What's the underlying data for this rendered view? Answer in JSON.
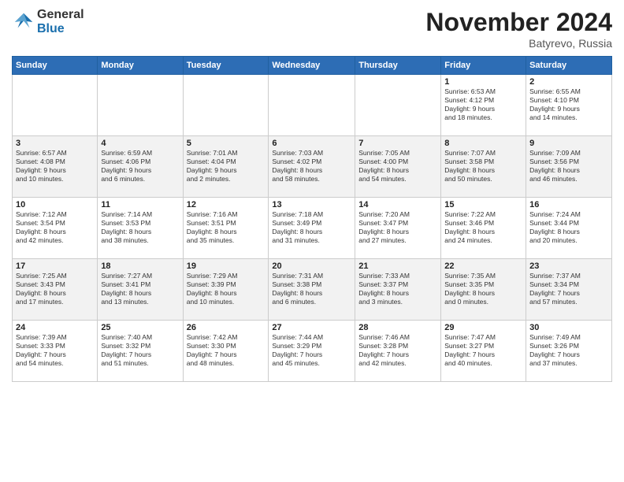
{
  "logo": {
    "general": "General",
    "blue": "Blue"
  },
  "header": {
    "month": "November 2024",
    "location": "Batyrevo, Russia"
  },
  "weekdays": [
    "Sunday",
    "Monday",
    "Tuesday",
    "Wednesday",
    "Thursday",
    "Friday",
    "Saturday"
  ],
  "weeks": [
    [
      {
        "day": "",
        "info": ""
      },
      {
        "day": "",
        "info": ""
      },
      {
        "day": "",
        "info": ""
      },
      {
        "day": "",
        "info": ""
      },
      {
        "day": "",
        "info": ""
      },
      {
        "day": "1",
        "info": "Sunrise: 6:53 AM\nSunset: 4:12 PM\nDaylight: 9 hours\nand 18 minutes."
      },
      {
        "day": "2",
        "info": "Sunrise: 6:55 AM\nSunset: 4:10 PM\nDaylight: 9 hours\nand 14 minutes."
      }
    ],
    [
      {
        "day": "3",
        "info": "Sunrise: 6:57 AM\nSunset: 4:08 PM\nDaylight: 9 hours\nand 10 minutes."
      },
      {
        "day": "4",
        "info": "Sunrise: 6:59 AM\nSunset: 4:06 PM\nDaylight: 9 hours\nand 6 minutes."
      },
      {
        "day": "5",
        "info": "Sunrise: 7:01 AM\nSunset: 4:04 PM\nDaylight: 9 hours\nand 2 minutes."
      },
      {
        "day": "6",
        "info": "Sunrise: 7:03 AM\nSunset: 4:02 PM\nDaylight: 8 hours\nand 58 minutes."
      },
      {
        "day": "7",
        "info": "Sunrise: 7:05 AM\nSunset: 4:00 PM\nDaylight: 8 hours\nand 54 minutes."
      },
      {
        "day": "8",
        "info": "Sunrise: 7:07 AM\nSunset: 3:58 PM\nDaylight: 8 hours\nand 50 minutes."
      },
      {
        "day": "9",
        "info": "Sunrise: 7:09 AM\nSunset: 3:56 PM\nDaylight: 8 hours\nand 46 minutes."
      }
    ],
    [
      {
        "day": "10",
        "info": "Sunrise: 7:12 AM\nSunset: 3:54 PM\nDaylight: 8 hours\nand 42 minutes."
      },
      {
        "day": "11",
        "info": "Sunrise: 7:14 AM\nSunset: 3:53 PM\nDaylight: 8 hours\nand 38 minutes."
      },
      {
        "day": "12",
        "info": "Sunrise: 7:16 AM\nSunset: 3:51 PM\nDaylight: 8 hours\nand 35 minutes."
      },
      {
        "day": "13",
        "info": "Sunrise: 7:18 AM\nSunset: 3:49 PM\nDaylight: 8 hours\nand 31 minutes."
      },
      {
        "day": "14",
        "info": "Sunrise: 7:20 AM\nSunset: 3:47 PM\nDaylight: 8 hours\nand 27 minutes."
      },
      {
        "day": "15",
        "info": "Sunrise: 7:22 AM\nSunset: 3:46 PM\nDaylight: 8 hours\nand 24 minutes."
      },
      {
        "day": "16",
        "info": "Sunrise: 7:24 AM\nSunset: 3:44 PM\nDaylight: 8 hours\nand 20 minutes."
      }
    ],
    [
      {
        "day": "17",
        "info": "Sunrise: 7:25 AM\nSunset: 3:43 PM\nDaylight: 8 hours\nand 17 minutes."
      },
      {
        "day": "18",
        "info": "Sunrise: 7:27 AM\nSunset: 3:41 PM\nDaylight: 8 hours\nand 13 minutes."
      },
      {
        "day": "19",
        "info": "Sunrise: 7:29 AM\nSunset: 3:39 PM\nDaylight: 8 hours\nand 10 minutes."
      },
      {
        "day": "20",
        "info": "Sunrise: 7:31 AM\nSunset: 3:38 PM\nDaylight: 8 hours\nand 6 minutes."
      },
      {
        "day": "21",
        "info": "Sunrise: 7:33 AM\nSunset: 3:37 PM\nDaylight: 8 hours\nand 3 minutes."
      },
      {
        "day": "22",
        "info": "Sunrise: 7:35 AM\nSunset: 3:35 PM\nDaylight: 8 hours\nand 0 minutes."
      },
      {
        "day": "23",
        "info": "Sunrise: 7:37 AM\nSunset: 3:34 PM\nDaylight: 7 hours\nand 57 minutes."
      }
    ],
    [
      {
        "day": "24",
        "info": "Sunrise: 7:39 AM\nSunset: 3:33 PM\nDaylight: 7 hours\nand 54 minutes."
      },
      {
        "day": "25",
        "info": "Sunrise: 7:40 AM\nSunset: 3:32 PM\nDaylight: 7 hours\nand 51 minutes."
      },
      {
        "day": "26",
        "info": "Sunrise: 7:42 AM\nSunset: 3:30 PM\nDaylight: 7 hours\nand 48 minutes."
      },
      {
        "day": "27",
        "info": "Sunrise: 7:44 AM\nSunset: 3:29 PM\nDaylight: 7 hours\nand 45 minutes."
      },
      {
        "day": "28",
        "info": "Sunrise: 7:46 AM\nSunset: 3:28 PM\nDaylight: 7 hours\nand 42 minutes."
      },
      {
        "day": "29",
        "info": "Sunrise: 7:47 AM\nSunset: 3:27 PM\nDaylight: 7 hours\nand 40 minutes."
      },
      {
        "day": "30",
        "info": "Sunrise: 7:49 AM\nSunset: 3:26 PM\nDaylight: 7 hours\nand 37 minutes."
      }
    ]
  ]
}
